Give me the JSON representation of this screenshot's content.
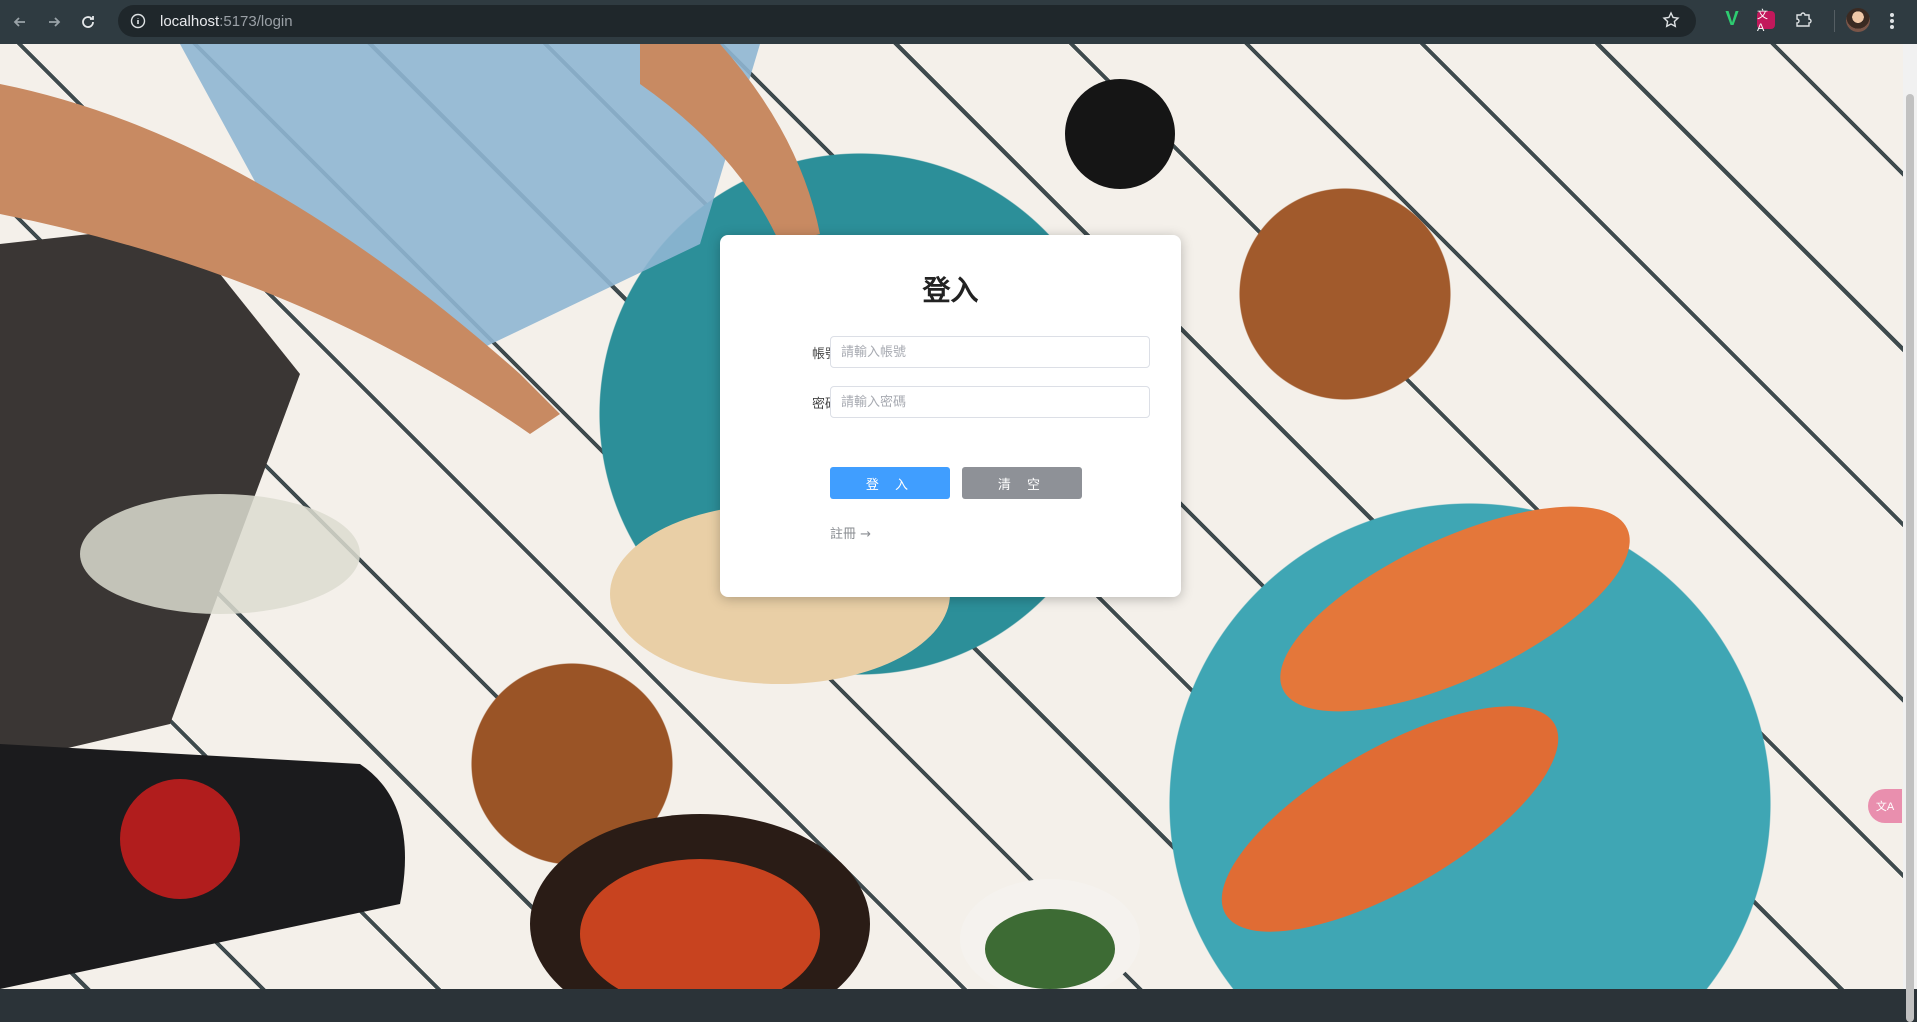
{
  "browser": {
    "url_host": "localhost",
    "url_rest": ":5173/login",
    "extensions": {
      "v_label": "V",
      "t_label": "文A"
    }
  },
  "page": {
    "title": "登入",
    "username": {
      "label": "帳號",
      "placeholder": "請輸入帳號"
    },
    "password": {
      "label": "密碼",
      "placeholder": "請輸入密碼"
    },
    "login_button": "登 入",
    "clear_button": "清 空",
    "register_link": "註冊 →",
    "badge_label": "文A"
  },
  "colors": {
    "primary": "#409eff",
    "secondary": "#8e9197",
    "chrome": "#2f3b41"
  }
}
